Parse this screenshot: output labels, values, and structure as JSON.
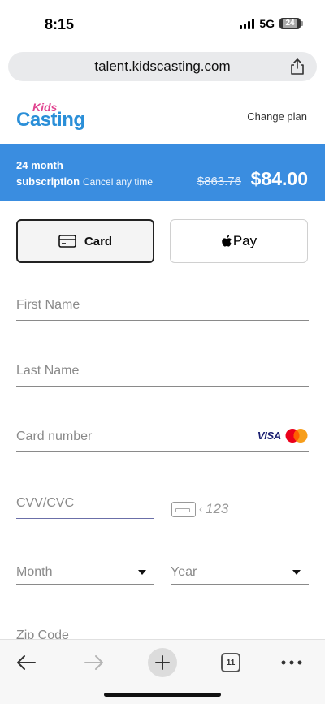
{
  "status_bar": {
    "time": "8:15",
    "network": "5G",
    "battery": "24"
  },
  "browser": {
    "url": "talent.kidscasting.com",
    "tab_count": "11"
  },
  "header": {
    "logo_kids": "Kids",
    "logo_casting": "Casting",
    "change_plan": "Change plan"
  },
  "banner": {
    "line1": "24 month",
    "line2": "subscription",
    "cancel_text": "Cancel any time",
    "old_price": "$863.76",
    "new_price": "$84.00",
    "color": "#3a8de0"
  },
  "payment_methods": {
    "card_label": "Card",
    "apple_pay_label": "Pay"
  },
  "form": {
    "first_name_placeholder": "First Name",
    "last_name_placeholder": "Last Name",
    "card_number_placeholder": "Card number",
    "visa_label": "VISA",
    "cvv_placeholder": "CVV/CVC",
    "cvv_example": "123",
    "month_placeholder": "Month",
    "year_placeholder": "Year",
    "zip_placeholder": "Zip Code"
  },
  "icons": {
    "share": "share-icon",
    "card": "credit-card-icon",
    "apple": "apple-logo-icon",
    "back": "back-arrow-icon",
    "forward": "forward-arrow-icon",
    "new_tab": "plus-icon",
    "tabs": "tabs-icon",
    "more": "more-dots-icon"
  }
}
